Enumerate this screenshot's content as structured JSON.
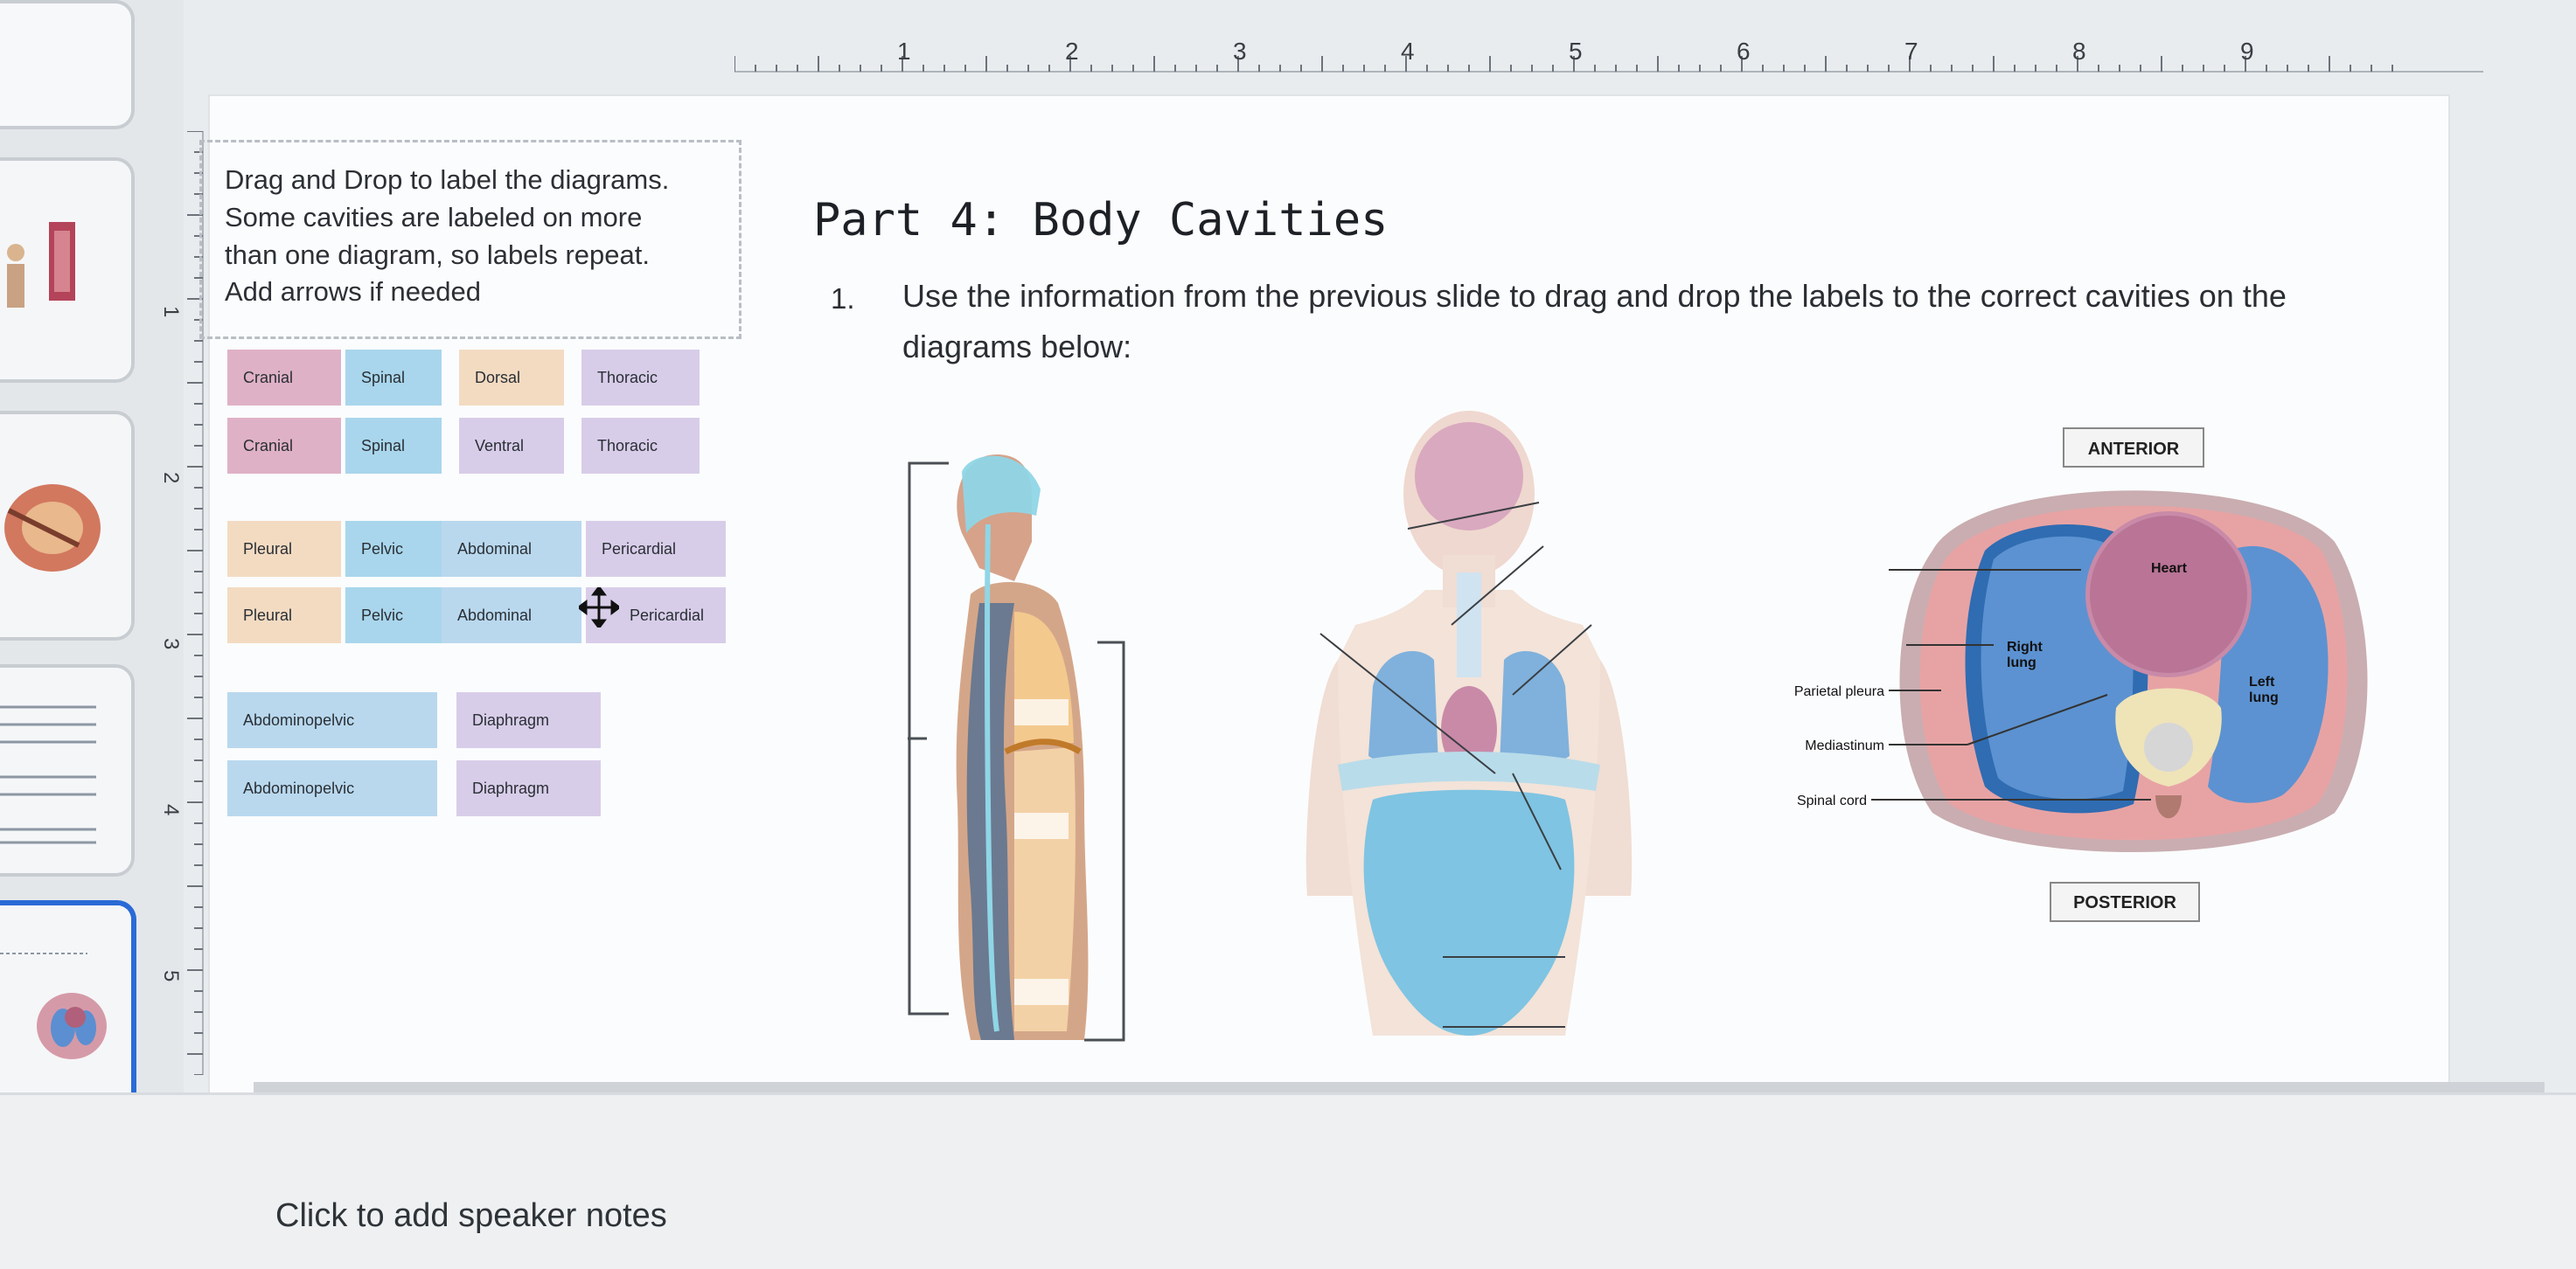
{
  "ruler": {
    "h_labels": [
      "1",
      "2",
      "3",
      "4",
      "5",
      "6",
      "7",
      "8",
      "9"
    ],
    "v_labels": [
      "1",
      "2",
      "3",
      "4",
      "5"
    ]
  },
  "instructions": {
    "line1": "Drag and Drop to label the diagrams.",
    "line2": "Some cavities are labeled on more",
    "line3": "than one diagram, so labels repeat.",
    "line4": "Add arrows if needed"
  },
  "labels": {
    "row1": [
      "Cranial",
      "Spinal",
      "Dorsal",
      "Thoracic"
    ],
    "row2": [
      "Cranial",
      "Spinal",
      "Ventral",
      "Thoracic"
    ],
    "row3": [
      "Pleural",
      "Pelvic",
      "Abdominal",
      "Pericardial"
    ],
    "row4": [
      "Pleural",
      "Pelvic",
      "Abdominal",
      "Pericardial"
    ],
    "row5": [
      "Abdominopelvic",
      "Diaphragm"
    ],
    "row6": [
      "Abdominopelvic",
      "Diaphragm"
    ]
  },
  "slide": {
    "title": "Part 4: Body Cavities",
    "question_number": "1.",
    "question_line1": "Use the information from the previous slide to drag and drop the labels to the correct cavities on the",
    "question_line2": "diagrams below:"
  },
  "cross_section": {
    "anterior": "ANTERIOR",
    "posterior": "POSTERIOR",
    "heart": "Heart",
    "right_lung_1": "Right",
    "right_lung_2": "lung",
    "left_lung_1": "Left",
    "left_lung_2": "lung",
    "parietal_pleura": "Parietal pleura",
    "mediastinum": "Mediastinum",
    "spinal_cord": "Spinal cord"
  },
  "notes": {
    "placeholder": "Click to add speaker notes"
  },
  "colors": {
    "accent": "#2a6ad6",
    "pink": "#dfb1c6",
    "blue": "#a9d6ec",
    "peach": "#f3dbc2",
    "lavender": "#d8cde9"
  }
}
